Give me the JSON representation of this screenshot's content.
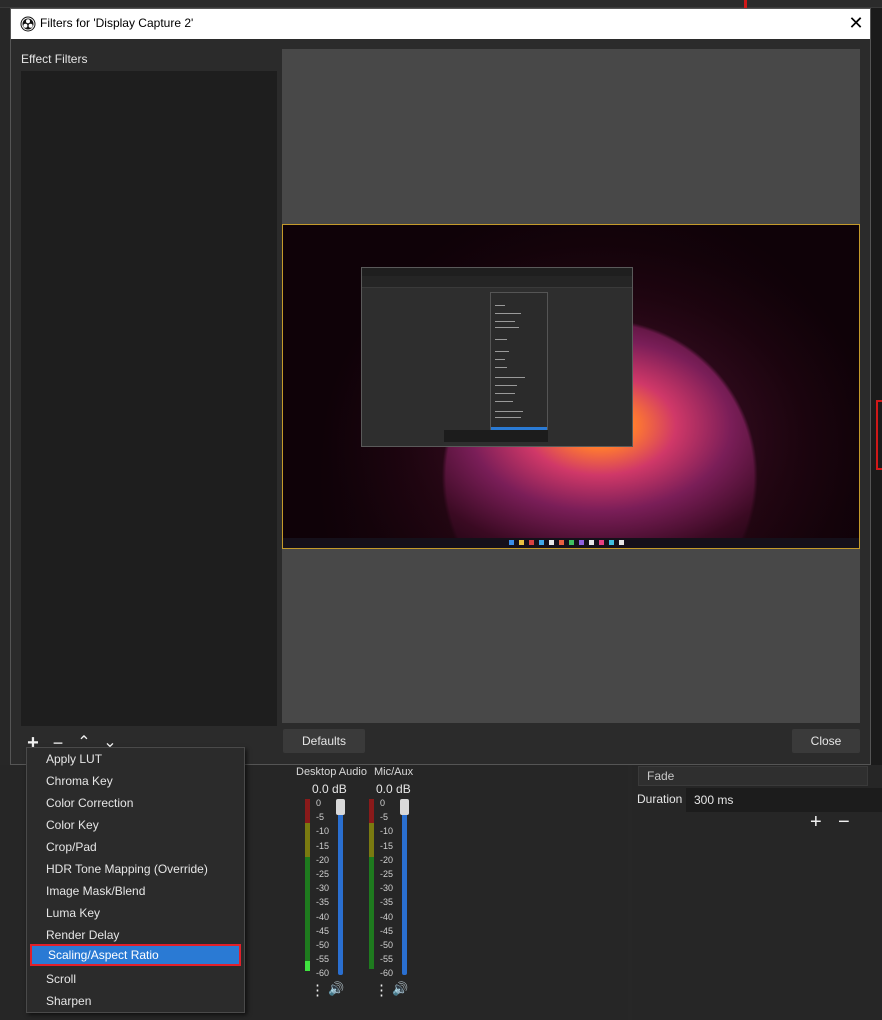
{
  "dialog": {
    "title": "Filters for 'Display Capture 2'",
    "close_glyph": "✕",
    "effect_filters_label": "Effect Filters",
    "defaults_label": "Defaults",
    "close_label": "Close"
  },
  "toolbar": {
    "add_glyph": "+",
    "remove_glyph": "−",
    "up_glyph": "⌃",
    "down_glyph": "⌄"
  },
  "filter_menu": {
    "items": [
      "Apply LUT",
      "Chroma Key",
      "Color Correction",
      "Color Key",
      "Crop/Pad",
      "HDR Tone Mapping (Override)",
      "Image Mask/Blend",
      "Luma Key",
      "Render Delay",
      "Scaling/Aspect Ratio",
      "Scroll",
      "Sharpen"
    ],
    "selected": "Scaling/Aspect Ratio"
  },
  "mixer": {
    "channels": [
      {
        "name": "Desktop Audio",
        "level": "0.0 dB"
      },
      {
        "name": "Mic/Aux",
        "level": "0.0 dB"
      }
    ],
    "scale": "0\n-5\n-10\n-15\n-20\n-25\n-30\n-35\n-40\n-45\n-50\n-55\n-60",
    "menu_glyph": "⋮",
    "speaker_glyph": "🔊"
  },
  "transitions": {
    "type": "Fade",
    "duration_label": "Duration",
    "duration_value": "300 ms",
    "add_glyph": "+",
    "remove_glyph": "−"
  },
  "icons": {
    "app": "obs-logo-icon",
    "close": "close-icon",
    "add": "plus-icon",
    "remove": "minus-icon",
    "move_up": "chevron-up-icon",
    "move_down": "chevron-down-icon"
  },
  "colors": {
    "selection": "#2a7ad4",
    "highlight_border": "#e2202a",
    "preview_border": "#c49a2a"
  }
}
